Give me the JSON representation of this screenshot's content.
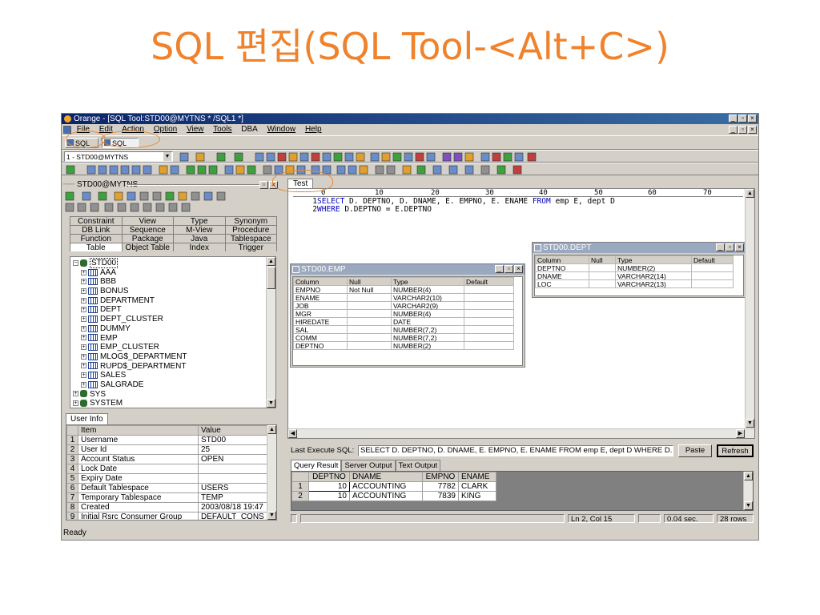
{
  "slide": {
    "title": "SQL 편집(SQL Tool-<Alt+C>)"
  },
  "window": {
    "title": "Orange - [SQL Tool:STD00@MYTNS * /SQL1 *]",
    "minimize": "_",
    "restore": "▫",
    "close": "×",
    "menu": [
      "File",
      "Edit",
      "Action",
      "Option",
      "View",
      "Tools",
      "DBA",
      "Window",
      "Help"
    ],
    "doc_tabs": [
      "SQL",
      "SQL"
    ],
    "connection": "1 - STD00@MYTNS"
  },
  "browser": {
    "header": "STD00@MYTNS",
    "tabs_row1": [
      "Constraint",
      "View",
      "Type",
      "Synonym"
    ],
    "tabs_row2": [
      "DB Link",
      "Sequence",
      "M-View",
      "Procedure"
    ],
    "tabs_row3": [
      "Function",
      "Package",
      "Java",
      "Tablespace"
    ],
    "tabs_row4": [
      "Table",
      "Object Table",
      "Index",
      "Trigger"
    ],
    "root": "STD00",
    "tables": [
      "AAA",
      "BBB",
      "BONUS",
      "DEPARTMENT",
      "DEPT",
      "DEPT_CLUSTER",
      "DUMMY",
      "EMP",
      "EMP_CLUSTER",
      "MLOG$_DEPARTMENT",
      "RUPD$_DEPARTMENT",
      "SALES",
      "SALGRADE"
    ],
    "others": [
      "SYS",
      "SYSTEM"
    ]
  },
  "user_info": {
    "tab": "User Info",
    "headers": [
      "Item",
      "Value"
    ],
    "rows": [
      {
        "n": "1",
        "item": "Username",
        "value": "STD00"
      },
      {
        "n": "2",
        "item": "User Id",
        "value": "25"
      },
      {
        "n": "3",
        "item": "Account Status",
        "value": "OPEN"
      },
      {
        "n": "4",
        "item": "Lock Date",
        "value": ""
      },
      {
        "n": "5",
        "item": "Expiry Date",
        "value": ""
      },
      {
        "n": "6",
        "item": "Default Tablespace",
        "value": "USERS"
      },
      {
        "n": "7",
        "item": "Temporary Tablespace",
        "value": "TEMP"
      },
      {
        "n": "8",
        "item": "Created",
        "value": "2003/08/18 19:47"
      },
      {
        "n": "9",
        "item": "Initial Rsrc Consumer Group",
        "value": "DEFAULT_CONS"
      }
    ]
  },
  "editor": {
    "tab": "Test",
    "ruler": [
      "0",
      "10",
      "20",
      "30",
      "40",
      "50",
      "60",
      "70"
    ],
    "line1_no": "1",
    "line1_kw1": "SELECT",
    "line1_mid": " D. DEPTNO, D. DNAME, E. EMPNO, E. ENAME ",
    "line1_kw2": "FROM",
    "line1_end": " emp E, dept D",
    "line2_no": "2",
    "line2_kw": "WHERE",
    "line2_rest": " D.DEPTNO = E.DEPTNO"
  },
  "emp_win": {
    "title": "STD00.EMP",
    "headers": [
      "Column",
      "Null",
      "Type",
      "Default"
    ],
    "rows": [
      [
        "EMPNO",
        "Not Null",
        "NUMBER(4)",
        ""
      ],
      [
        "ENAME",
        "",
        "VARCHAR2(10)",
        ""
      ],
      [
        "JOB",
        "",
        "VARCHAR2(9)",
        ""
      ],
      [
        "MGR",
        "",
        "NUMBER(4)",
        ""
      ],
      [
        "HIREDATE",
        "",
        "DATE",
        ""
      ],
      [
        "SAL",
        "",
        "NUMBER(7,2)",
        ""
      ],
      [
        "COMM",
        "",
        "NUMBER(7,2)",
        ""
      ],
      [
        "DEPTNO",
        "",
        "NUMBER(2)",
        ""
      ]
    ]
  },
  "dept_win": {
    "title": "STD00.DEPT",
    "headers": [
      "Column",
      "Null",
      "Type",
      "Default"
    ],
    "rows": [
      [
        "DEPTNO",
        "",
        "NUMBER(2)",
        ""
      ],
      [
        "DNAME",
        "",
        "VARCHAR2(14)",
        ""
      ],
      [
        "LOC",
        "",
        "VARCHAR2(13)",
        ""
      ]
    ]
  },
  "result": {
    "last_label": "Last Execute SQL:",
    "last_sql": "SELECT D. DEPTNO, D. DNAME, E. EMPNO, E. ENAME FROM emp E, dept D WHERE D.DEPTN...",
    "paste": "Paste",
    "refresh": "Refresh",
    "tabs": [
      "Query Result",
      "Server Output",
      "Text Output"
    ],
    "headers": [
      "DEPTNO",
      "DNAME",
      "EMPNO",
      "ENAME"
    ],
    "rows": [
      {
        "n": "1",
        "deptno": "10",
        "dname": "ACCOUNTING",
        "empno": "7782",
        "ename": "CLARK"
      },
      {
        "n": "2",
        "deptno": "10",
        "dname": "ACCOUNTING",
        "empno": "7839",
        "ename": "KING"
      }
    ],
    "pos": "Ln 2, Col 15",
    "time": "0.04 sec.",
    "count": "28 rows"
  },
  "status": {
    "text": "Ready"
  },
  "colors": {
    "title": "#f0822c",
    "keyword": "#0000c0",
    "titlebar": "#0a246a",
    "highlight": "#e8862e"
  }
}
